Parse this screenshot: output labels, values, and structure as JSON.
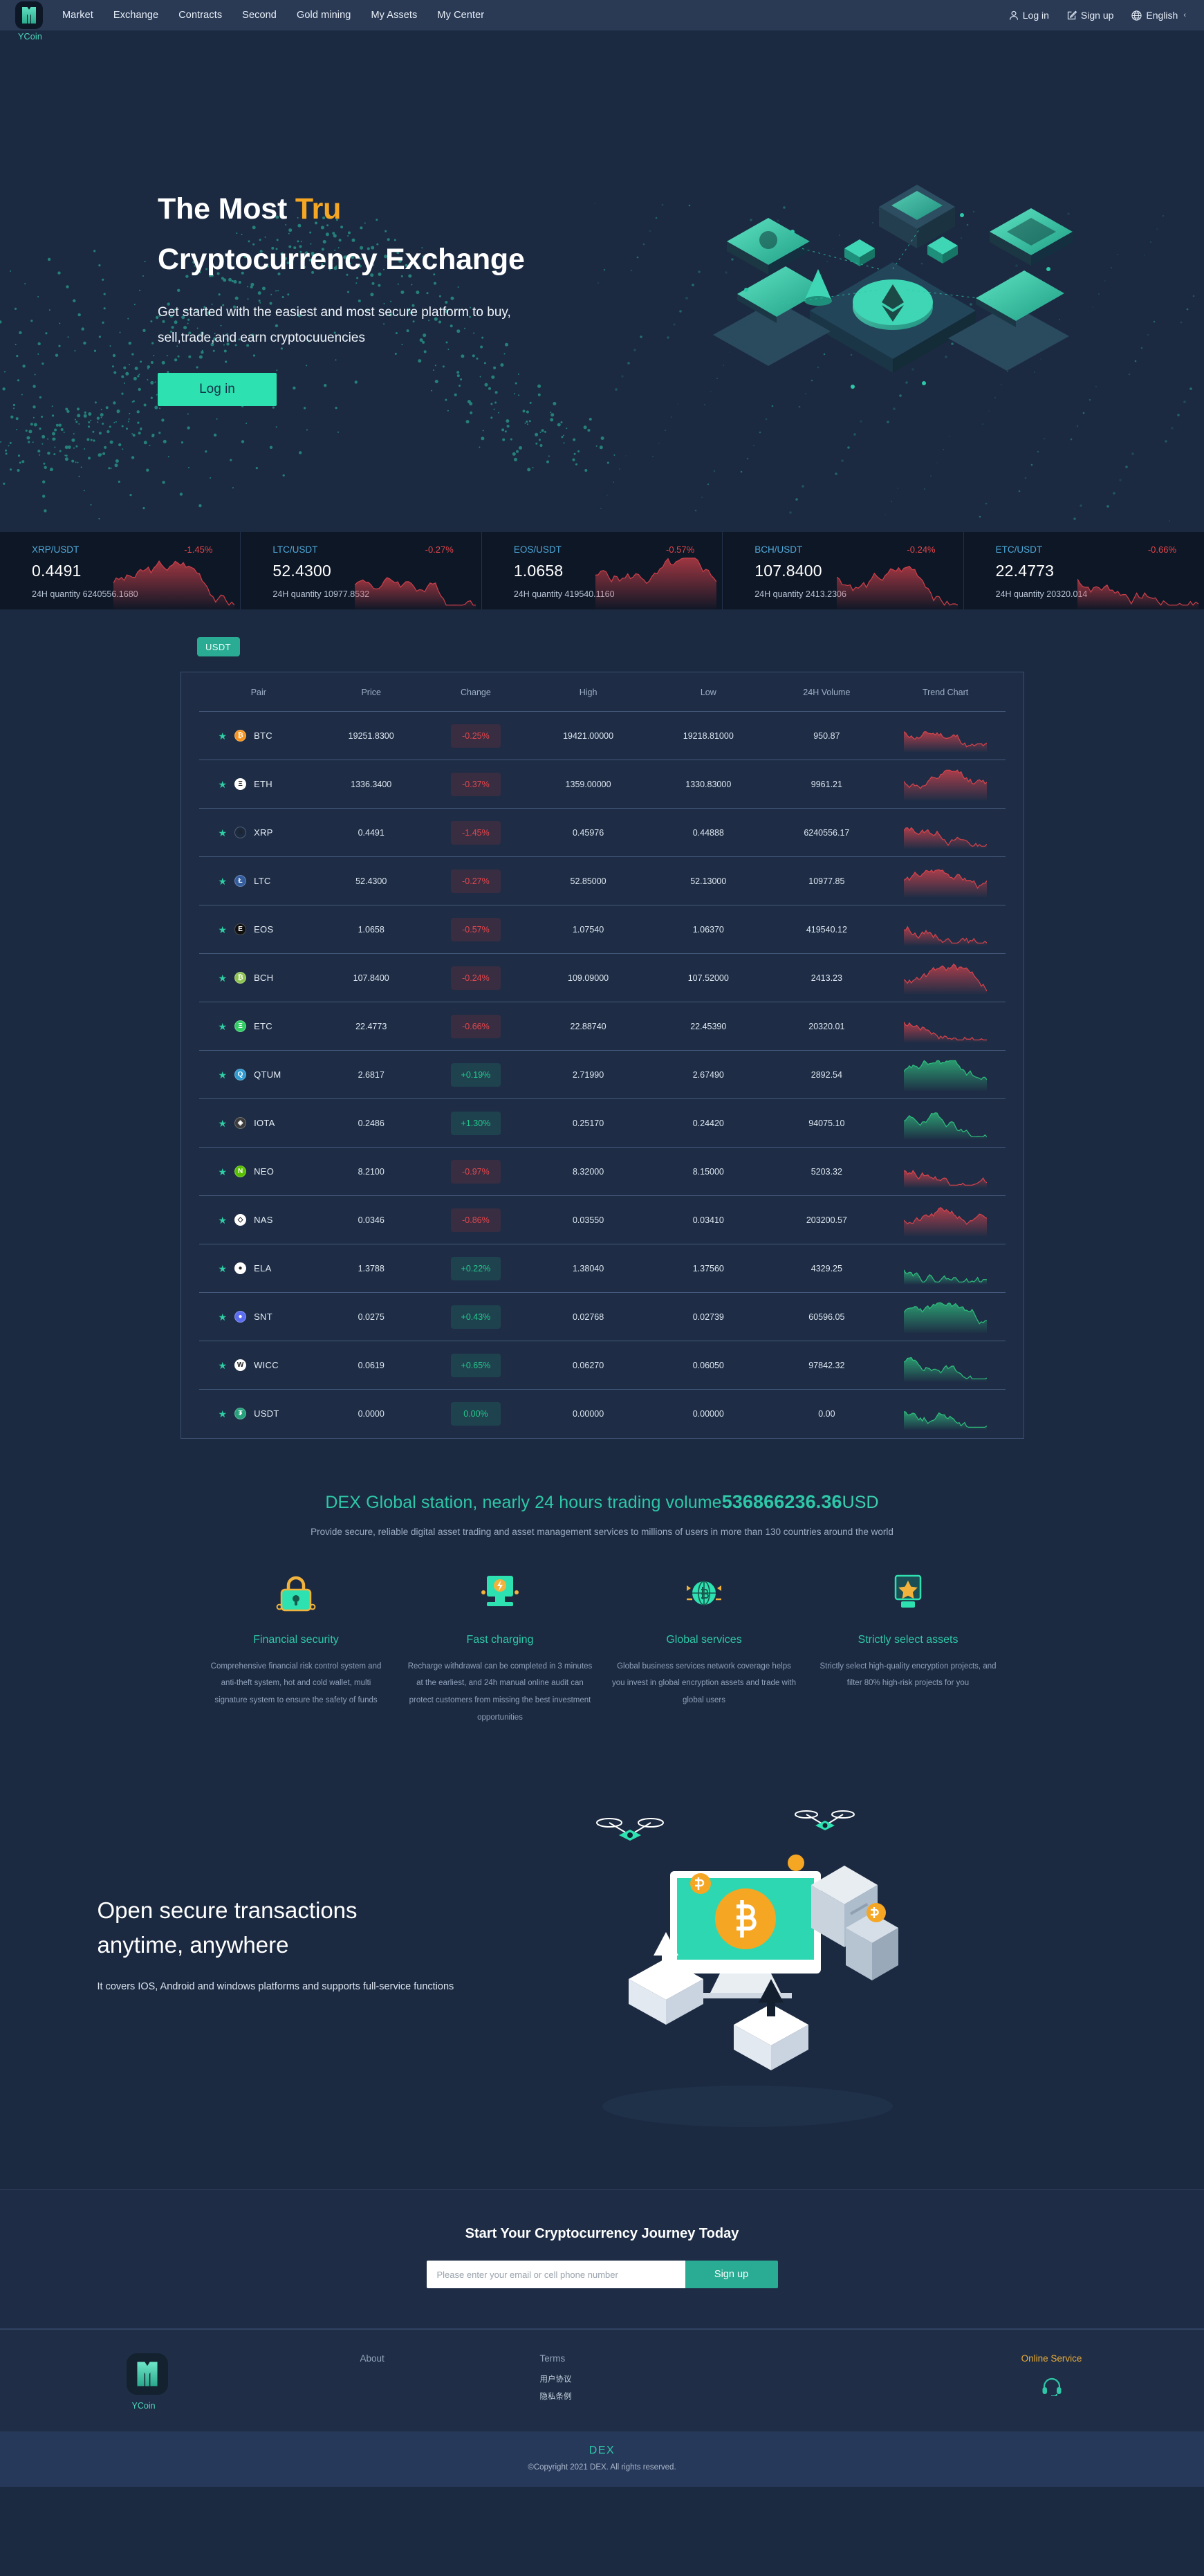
{
  "nav": {
    "logo_caption": "YCoin",
    "links": [
      "Market",
      "Exchange",
      "Contracts",
      "Second",
      "Gold mining",
      "My Assets",
      "My Center"
    ],
    "login": "Log in",
    "signup": "Sign up",
    "language": "English"
  },
  "hero": {
    "title_line1_a": "The Most ",
    "title_line1_b": "Tru",
    "title_line2": "Cryptocurrency Exchange",
    "sub_line1": "Get started with the easiest and most secure platform to buy,",
    "sub_line2": "sell,trade,and earn cryptocuuencies",
    "cta": "Log in"
  },
  "ticker": [
    {
      "pair": "XRP/USDT",
      "change": "-1.45%",
      "dir": "down",
      "price": "0.4491",
      "qty": "24H quantity 6240556.1680"
    },
    {
      "pair": "LTC/USDT",
      "change": "-0.27%",
      "dir": "down",
      "price": "52.4300",
      "qty": "24H quantity 10977.8532"
    },
    {
      "pair": "EOS/USDT",
      "change": "-0.57%",
      "dir": "down",
      "price": "1.0658",
      "qty": "24H quantity 419540.1160"
    },
    {
      "pair": "BCH/USDT",
      "change": "-0.24%",
      "dir": "down",
      "price": "107.8400",
      "qty": "24H quantity 2413.2306"
    },
    {
      "pair": "ETC/USDT",
      "change": "-0.66%",
      "dir": "down",
      "price": "22.4773",
      "qty": "24H quantity 20320.014"
    }
  ],
  "market": {
    "tab": "USDT",
    "columns": [
      "Pair",
      "Price",
      "Change",
      "High",
      "Low",
      "24H Volume",
      "Trend Chart"
    ],
    "rows": [
      {
        "pair": "BTC",
        "price": "19251.8300",
        "change": "-0.25%",
        "dir": "down",
        "high": "19421.00000",
        "low": "19218.81000",
        "volume": "950.87",
        "coin_color": "#f7941e",
        "coin_glyph": "₿"
      },
      {
        "pair": "ETH",
        "price": "1336.3400",
        "change": "-0.37%",
        "dir": "down",
        "high": "1359.00000",
        "low": "1330.83000",
        "volume": "9961.21",
        "coin_color": "#ffffff",
        "coin_glyph": "Ξ"
      },
      {
        "pair": "XRP",
        "price": "0.4491",
        "change": "-1.45%",
        "dir": "down",
        "high": "0.45976",
        "low": "0.44888",
        "volume": "6240556.17",
        "coin_color": "#1b2a41",
        "coin_glyph": "✕"
      },
      {
        "pair": "LTC",
        "price": "52.4300",
        "change": "-0.27%",
        "dir": "down",
        "high": "52.85000",
        "low": "52.13000",
        "volume": "10977.85",
        "coin_color": "#345d9d",
        "coin_glyph": "Ł"
      },
      {
        "pair": "EOS",
        "price": "1.0658",
        "change": "-0.57%",
        "dir": "down",
        "high": "1.07540",
        "low": "1.06370",
        "volume": "419540.12",
        "coin_color": "#101010",
        "coin_glyph": "E"
      },
      {
        "pair": "BCH",
        "price": "107.8400",
        "change": "-0.24%",
        "dir": "down",
        "high": "109.09000",
        "low": "107.52000",
        "volume": "2413.23",
        "coin_color": "#8dc351",
        "coin_glyph": "₿"
      },
      {
        "pair": "ETC",
        "price": "22.4773",
        "change": "-0.66%",
        "dir": "down",
        "high": "22.88740",
        "low": "22.45390",
        "volume": "20320.01",
        "coin_color": "#33cc66",
        "coin_glyph": "Ξ"
      },
      {
        "pair": "QTUM",
        "price": "2.6817",
        "change": "+0.19%",
        "dir": "up",
        "high": "2.71990",
        "low": "2.67490",
        "volume": "2892.54",
        "coin_color": "#2e9ad0",
        "coin_glyph": "Q"
      },
      {
        "pair": "IOTA",
        "price": "0.2486",
        "change": "+1.30%",
        "dir": "up",
        "high": "0.25170",
        "low": "0.24420",
        "volume": "94075.10",
        "coin_color": "#3c3c3c",
        "coin_glyph": "◈"
      },
      {
        "pair": "NEO",
        "price": "8.2100",
        "change": "-0.97%",
        "dir": "down",
        "high": "8.32000",
        "low": "8.15000",
        "volume": "5203.32",
        "coin_color": "#58bf00",
        "coin_glyph": "N"
      },
      {
        "pair": "NAS",
        "price": "0.0346",
        "change": "-0.86%",
        "dir": "down",
        "high": "0.03550",
        "low": "0.03410",
        "volume": "203200.57",
        "coin_color": "#ffffff",
        "coin_glyph": "◇"
      },
      {
        "pair": "ELA",
        "price": "1.3788",
        "change": "+0.22%",
        "dir": "up",
        "high": "1.38040",
        "low": "1.37560",
        "volume": "4329.25",
        "coin_color": "#ffffff",
        "coin_glyph": "●"
      },
      {
        "pair": "SNT",
        "price": "0.0275",
        "change": "+0.43%",
        "dir": "up",
        "high": "0.02768",
        "low": "0.02739",
        "volume": "60596.05",
        "coin_color": "#5b6dee",
        "coin_glyph": "●"
      },
      {
        "pair": "WICC",
        "price": "0.0619",
        "change": "+0.65%",
        "dir": "up",
        "high": "0.06270",
        "low": "0.06050",
        "volume": "97842.32",
        "coin_color": "#ffffff",
        "coin_glyph": "W"
      },
      {
        "pair": "USDT",
        "price": "0.0000",
        "change": "0.00%",
        "dir": "up",
        "high": "0.00000",
        "low": "0.00000",
        "volume": "0.00",
        "coin_color": "#26a17b",
        "coin_glyph": "₮"
      }
    ]
  },
  "stats": {
    "headline_a": "DEX Global station, nearly 24 hours trading volume",
    "headline_volume": "536866236.36",
    "headline_b": "USD",
    "desc": "Provide secure, reliable digital asset trading and asset management services to millions of users in more than 130 countries around the world"
  },
  "features": [
    {
      "icon": "lock-icon",
      "title": "Financial security",
      "text": "Comprehensive financial risk control system and anti-theft system, hot and cold wallet, multi signature system to ensure the safety of funds"
    },
    {
      "icon": "lightning-coin-icon",
      "title": "Fast charging",
      "text": "Recharge withdrawal can be completed in 3 minutes at the earliest, and 24h manual online audit can protect customers from missing the best investment opportunities"
    },
    {
      "icon": "globe-bitcoin-icon",
      "title": "Global services",
      "text": "Global business services network coverage helps you invest in global encryption assets and trade with global users"
    },
    {
      "icon": "star-shield-icon",
      "title": "Strictly select assets",
      "text": "Strictly select high-quality encryption projects, and filter 80% high-risk projects for you"
    }
  ],
  "app_section": {
    "title_line1": "Open secure transactions",
    "title_line2": "anytime, anywhere",
    "desc": "It covers IOS, Android and windows platforms and supports full-service functions"
  },
  "cta": {
    "title": "Start Your Cryptocurrency Journey Today",
    "placeholder": "Please enter your email or cell phone number",
    "button": "Sign up"
  },
  "footer": {
    "logo_caption": "YCoin",
    "about_title": "About",
    "terms_title": "Terms",
    "terms_links": [
      "用户协议",
      "隐私条例"
    ],
    "service_title": "Online Service"
  },
  "copyright": {
    "brand": "DEX",
    "text": "©Copyright 2021 DEX. All rights reserved."
  },
  "colors": {
    "accent_green": "#2ec7a7",
    "accent_orange": "#f5a623",
    "down_red": "#e2464b",
    "up_green": "#23c98c",
    "bg": "#1b2a41"
  }
}
